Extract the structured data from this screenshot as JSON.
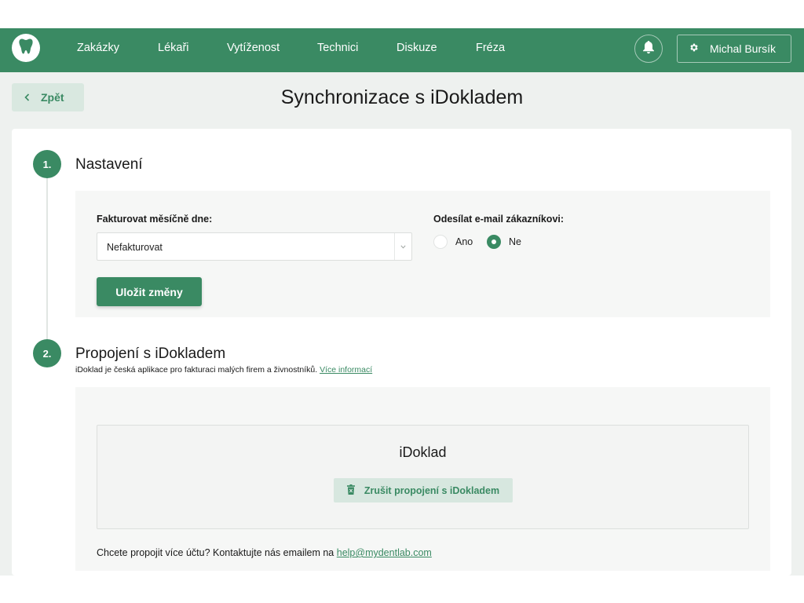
{
  "nav": {
    "logo_icon": "tooth-icon",
    "items": [
      "Zakázky",
      "Lékaři",
      "Vytíženost",
      "Technici",
      "Diskuze",
      "Fréza"
    ],
    "bell_icon": "bell-icon",
    "user_name": "Michal Bursík",
    "user_icon": "gear-icon"
  },
  "header": {
    "back_label": "Zpět",
    "title": "Synchronizace s iDokladem"
  },
  "step1": {
    "number": "1.",
    "title": "Nastavení",
    "invoice_label": "Fakturovat měsíčně dne:",
    "invoice_value": "Nefakturovat",
    "email_label": "Odesílat e-mail zákazníkovi:",
    "radio_yes": "Ano",
    "radio_no": "Ne",
    "selected": "Ne",
    "save_label": "Uložit změny"
  },
  "step2": {
    "number": "2.",
    "title": "Propojení s iDokladem",
    "description": "iDoklad je česká aplikace pro fakturaci malých firem a živnostníků.",
    "more_link": "Více informací",
    "box_title": "iDoklad",
    "disconnect_label": "Zrušit propojení s iDokladem",
    "contact_text": "Chcete propojit více účtu? Kontaktujte nás emailem na",
    "contact_email": "help@mydentlab.com"
  },
  "colors": {
    "brand": "#3a8a63",
    "page_bg": "#eef1ef",
    "panel_bg": "#f6f7f6"
  }
}
